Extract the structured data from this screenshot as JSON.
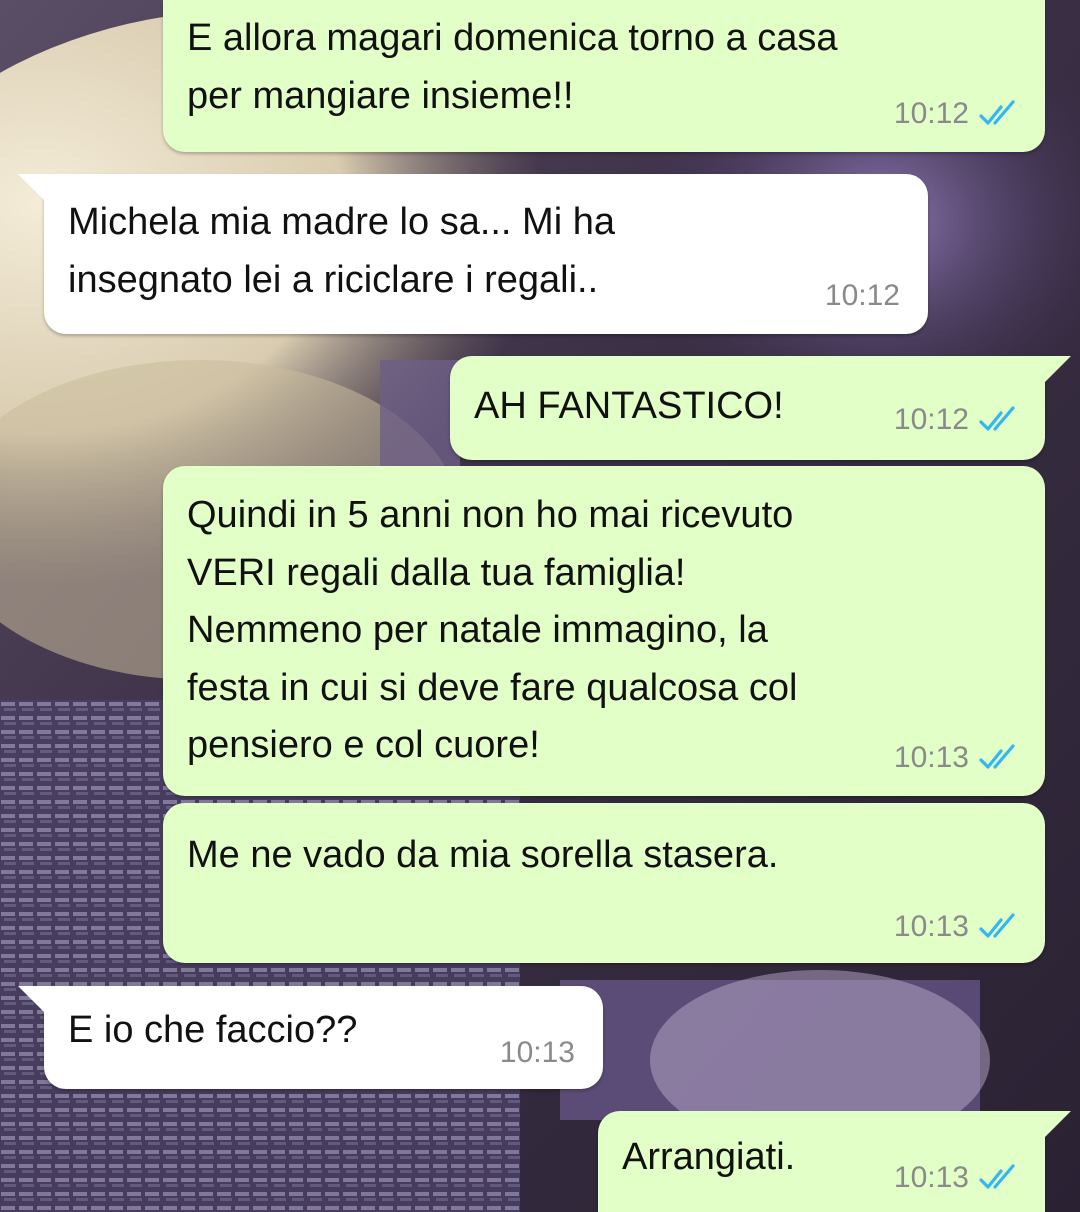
{
  "chat": {
    "messages": [
      {
        "direction": "out",
        "text": "E allora magari domenica torno a casa\nper mangiare insieme!!",
        "time": "10:12",
        "status_icon": "double-check-read-icon"
      },
      {
        "direction": "in",
        "text": "Michela mia madre lo sa... Mi ha\ninsegnato lei a riciclare i regali..",
        "time": "10:12"
      },
      {
        "direction": "out",
        "text": "AH FANTASTICO!",
        "time": "10:12",
        "status_icon": "double-check-read-icon"
      },
      {
        "direction": "out",
        "text": "Quindi in 5 anni non ho mai ricevuto\nVERI regali dalla tua famiglia!\nNemmeno per natale immagino, la\nfesta in cui si deve fare qualcosa col\npensiero e col cuore!",
        "time": "10:13",
        "status_icon": "double-check-read-icon"
      },
      {
        "direction": "out",
        "text": "Me ne vado da mia sorella stasera.",
        "time": "10:13",
        "status_icon": "double-check-read-icon"
      },
      {
        "direction": "in",
        "text": "E io che faccio??",
        "time": "10:13"
      },
      {
        "direction": "out",
        "text": "Arrangiati.",
        "time": "10:13",
        "status_icon": "double-check-read-icon"
      }
    ]
  },
  "colors": {
    "outgoing_bubble": "#e2ffc7",
    "incoming_bubble": "#ffffff",
    "read_ticks": "#34b7f1",
    "timestamp": "#8a8a8a"
  }
}
